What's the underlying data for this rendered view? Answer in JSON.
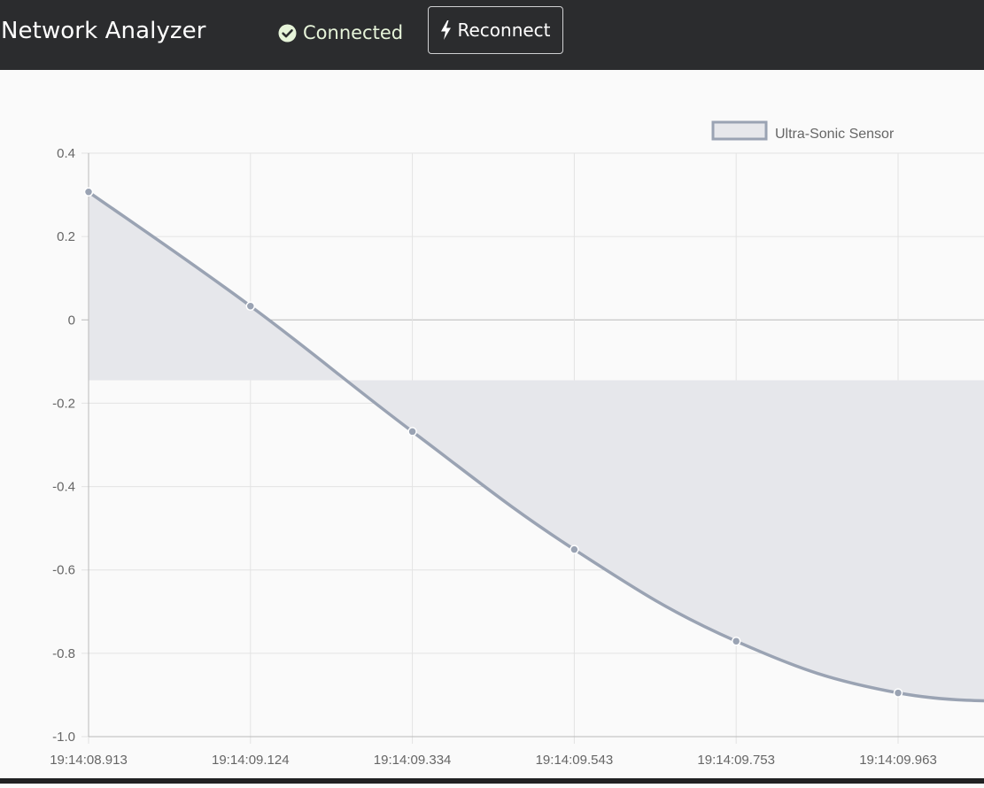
{
  "header": {
    "title": "Network Analyzer",
    "status_label": "Connected",
    "reconnect_label": "Reconnect",
    "status_color": "#e6f4d9",
    "background": "#2b2c2e",
    "status_icon": "check-circle-icon",
    "reconnect_icon": "lightning-bolt-icon"
  },
  "chart_data": {
    "type": "line",
    "x": [
      "19:14:08.913",
      "19:14:09.124",
      "19:14:09.334",
      "19:14:09.543",
      "19:14:09.753",
      "19:14:09.963"
    ],
    "series": [
      {
        "name": "Ultra-Sonic Sensor",
        "values": [
          0.307,
          0.033,
          -0.268,
          -0.551,
          -0.771,
          -0.895
        ],
        "color": "#9aa3b3",
        "fill": "#e6e7eb"
      }
    ],
    "trailing_value": -0.915,
    "ylim": [
      -1.0,
      0.4
    ],
    "yticks": [
      0.4,
      0.2,
      0,
      -0.2,
      -0.4,
      -0.6,
      -0.8,
      -1.0
    ],
    "ytick_labels": [
      "0.4",
      "0.2",
      "0",
      "-0.2",
      "-0.4",
      "-0.6",
      "-0.8",
      "-1.0"
    ],
    "fill_baseline": -0.145,
    "grid": true,
    "legend_position": "top-right",
    "title": "",
    "xlabel": "",
    "ylabel": ""
  }
}
